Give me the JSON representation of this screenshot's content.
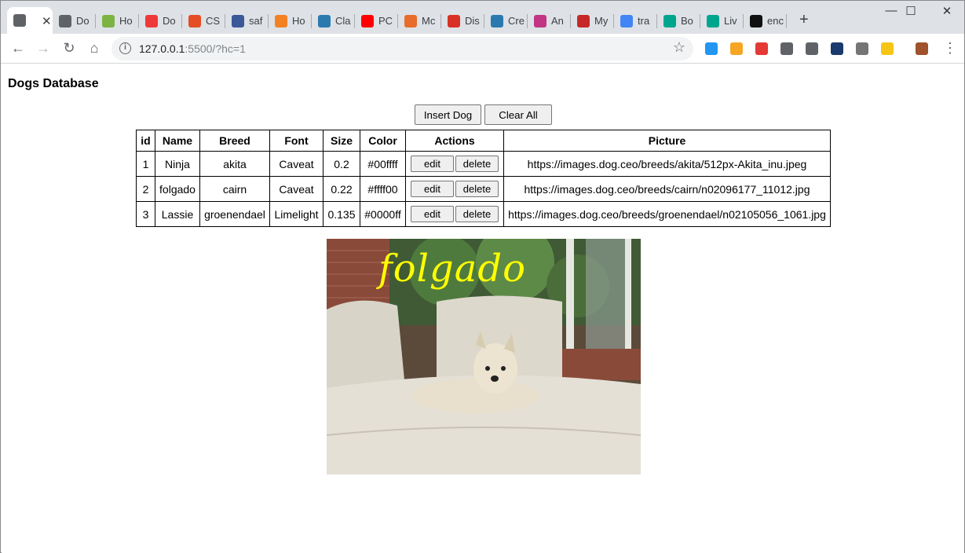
{
  "browser": {
    "tabs": [
      {
        "title": "",
        "icon": "globe-icon",
        "color": "#5f6368",
        "active": true
      },
      {
        "title": "Do",
        "icon": "globe-icon",
        "color": "#5f6368"
      },
      {
        "title": "Ho",
        "icon": "code-icon",
        "color": "#7cb342"
      },
      {
        "title": "Do",
        "icon": "vivaldi-icon",
        "color": "#ef3939"
      },
      {
        "title": "CS",
        "icon": "html5-icon",
        "color": "#e44d26"
      },
      {
        "title": "saf",
        "icon": "facebook-icon",
        "color": "#3b5998"
      },
      {
        "title": "Ho",
        "icon": "stackoverflow-icon",
        "color": "#f48024"
      },
      {
        "title": "Cla",
        "icon": "classroom-icon",
        "color": "#2a7ab0"
      },
      {
        "title": "PC",
        "icon": "youtube-icon",
        "color": "#ff0000"
      },
      {
        "title": "Mc",
        "icon": "hand-icon",
        "color": "#e86d2b"
      },
      {
        "title": "Dis",
        "icon": "figure-icon",
        "color": "#d93025"
      },
      {
        "title": "Cre",
        "icon": "classroom-icon",
        "color": "#2a7ab0"
      },
      {
        "title": "An",
        "icon": "instagram-icon",
        "color": "#c13584"
      },
      {
        "title": "My",
        "icon": "dots-icon",
        "color": "#c62828"
      },
      {
        "title": "tra",
        "icon": "google-icon",
        "color": "#4285f4"
      },
      {
        "title": "Bo",
        "icon": "hex-icon",
        "color": "#00a58e"
      },
      {
        "title": "Liv",
        "icon": "hex-icon",
        "color": "#00a58e"
      },
      {
        "title": "enc",
        "icon": "github-icon",
        "color": "#111111"
      }
    ],
    "new_tab": "+",
    "window_controls": {
      "minimize": "—",
      "maximize": "☐",
      "close": "✕"
    },
    "url_host": "127.0.0.1",
    "url_rest": ":5500/?hc=1",
    "extensions": [
      "#2196f3",
      "#f6a623",
      "#e53935",
      "#5f6368",
      "#5f6368",
      "#1a3a6e",
      "#757575",
      "#f5c518",
      "#a0522d"
    ]
  },
  "page": {
    "title": "Dogs Database",
    "insert_label": "Insert Dog",
    "clear_label": "Clear All",
    "columns": [
      "id",
      "Name",
      "Breed",
      "Font",
      "Size",
      "Color",
      "Actions",
      "Picture"
    ],
    "edit_label": "edit",
    "delete_label": "delete",
    "rows": [
      {
        "id": "1",
        "name": "Ninja",
        "breed": "akita",
        "font": "Caveat",
        "size": "0.2",
        "color": "#00ffff",
        "picture": "https://images.dog.ceo/breeds/akita/512px-Akita_inu.jpeg"
      },
      {
        "id": "2",
        "name": "folgado",
        "breed": "cairn",
        "font": "Caveat",
        "size": "0.22",
        "color": "#ffff00",
        "picture": "https://images.dog.ceo/breeds/cairn/n02096177_11012.jpg"
      },
      {
        "id": "3",
        "name": "Lassie",
        "breed": "groenendael",
        "font": "Limelight",
        "size": "0.135",
        "color": "#0000ff",
        "picture": "https://images.dog.ceo/breeds/groenendael/n02105056_1061.jpg"
      }
    ],
    "picture_caption": "folgado",
    "picture_caption_color": "#ffff00"
  }
}
